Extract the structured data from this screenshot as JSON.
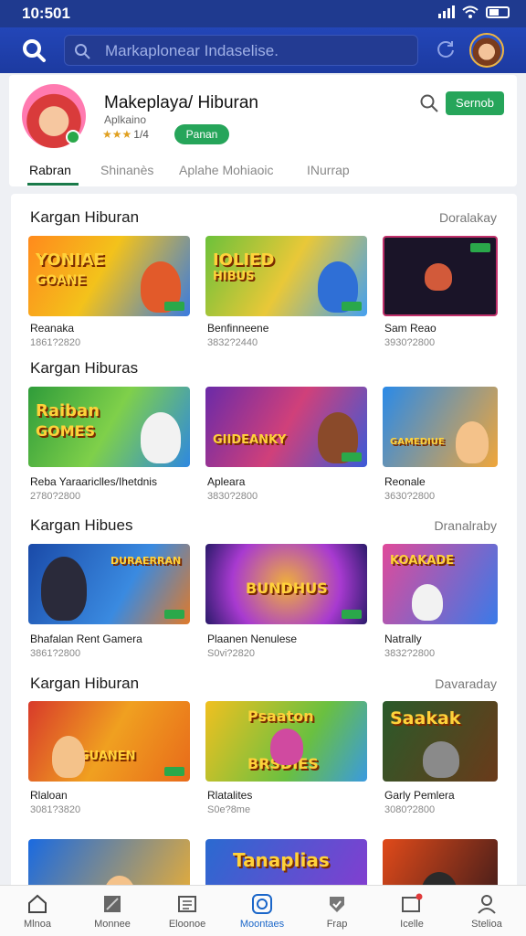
{
  "status_bar": {
    "time": "10:501"
  },
  "top_bar": {
    "search_placeholder": "Markaplonear Indaselise."
  },
  "app_header": {
    "title": "Makeplaya/ Hiburan",
    "subtitle": "Aplkaino",
    "rating_stars": "★★★",
    "rating_value": "1/4",
    "install_label": "Panan",
    "action_label": "Sernob",
    "tabs": [
      "Rabran",
      "Shinanès",
      "Aplahe Mohiaoic",
      "INurrap"
    ]
  },
  "sections": [
    {
      "title": "Kargan Hiburan",
      "more": "Doralakay",
      "items": [
        {
          "tile_text": "YONIAE",
          "tile_text2": "GOANE",
          "name": "Reanaka",
          "meta": "1861?2820"
        },
        {
          "tile_text": "IOLIED",
          "tile_text2": "HIBUS",
          "name": "Benfinneene",
          "meta": "3832?2440"
        },
        {
          "tile_text": "",
          "tile_text2": "",
          "name": "Sam Reao",
          "meta": "3930?2800"
        }
      ]
    },
    {
      "title": "Kargan Hiburas",
      "more": "",
      "items": [
        {
          "tile_text": "Raiban",
          "tile_text2": "GOMES",
          "name": "Reba Yaraariclles/Ihetdnis",
          "meta": "2780?2800"
        },
        {
          "tile_text": "",
          "tile_text2": "GIIDEANKY",
          "name": "Apleara",
          "meta": "3830?2800"
        },
        {
          "tile_text": "",
          "tile_text2": "GAMEDIUE",
          "name": "Reonale",
          "meta": "3630?2800"
        }
      ]
    },
    {
      "title": "Kargan Hibues",
      "more": "Dranalraby",
      "items": [
        {
          "tile_text": "DURAERRAN",
          "tile_text2": "",
          "name": "Bhafalan Rent Gamera",
          "meta": "3861?2800"
        },
        {
          "tile_text": "BUNDHUS",
          "tile_text2": "",
          "name": "Plaanen Nenulese",
          "meta": "S0vi?2820"
        },
        {
          "tile_text": "KOAKADE",
          "tile_text2": "",
          "name": "Natrally",
          "meta": "3832?2800"
        }
      ]
    },
    {
      "title": "Kargan Hiburan",
      "more": "Davaraday",
      "items": [
        {
          "tile_text": "",
          "tile_text2": "GUANEN",
          "name": "Rlaloan",
          "meta": "3081?3820"
        },
        {
          "tile_text": "Psaaton",
          "tile_text2": "BRSDIES",
          "name": "Rlatalites",
          "meta": "S0e?8me"
        },
        {
          "tile_text": "Saakak",
          "tile_text2": "",
          "name": "Garly Pemlera",
          "meta": "3080?2800"
        }
      ]
    },
    {
      "title": "",
      "more": "",
      "items": [
        {
          "tile_text": "",
          "tile_text2": "",
          "name": "",
          "meta": ""
        },
        {
          "tile_text": "Tanaplias",
          "tile_text2": "",
          "name": "",
          "meta": ""
        },
        {
          "tile_text": "",
          "tile_text2": "",
          "name": "",
          "meta": ""
        }
      ]
    }
  ],
  "bottom_nav": [
    {
      "label": "Mlnoa",
      "icon": "home-icon"
    },
    {
      "label": "Monnee",
      "icon": "tablet-icon"
    },
    {
      "label": "Eloonoe",
      "icon": "book-icon"
    },
    {
      "label": "Moontaes",
      "icon": "app-icon"
    },
    {
      "label": "Frap",
      "icon": "shield-icon"
    },
    {
      "label": "Icelle",
      "icon": "inbox-icon"
    },
    {
      "label": "Stelioa",
      "icon": "profile-icon"
    }
  ],
  "colors": {
    "brand_blue": "#1f3a8f",
    "accent_green": "#26a55a",
    "active_nav": "#1a66c9"
  }
}
